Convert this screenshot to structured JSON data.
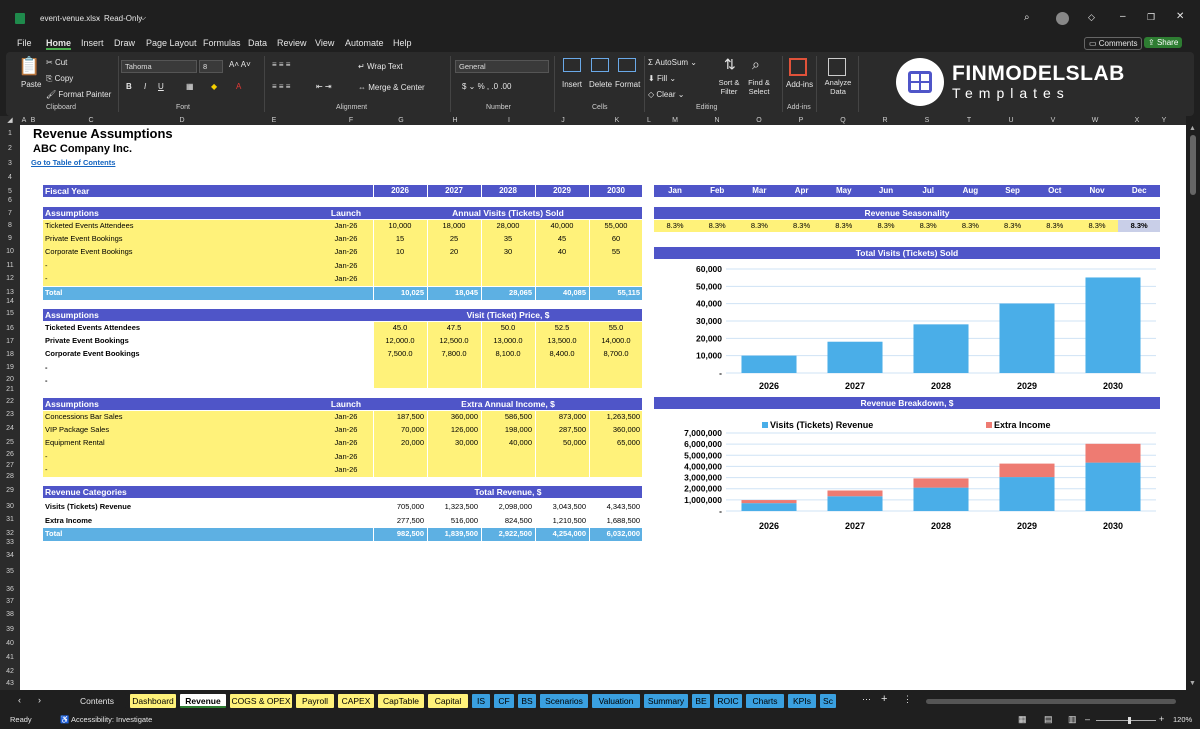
{
  "window": {
    "filename": "event-venue.xlsx",
    "mode": "Read-Only"
  },
  "menu": [
    "File",
    "Home",
    "Insert",
    "Draw",
    "Page Layout",
    "Formulas",
    "Data",
    "Review",
    "View",
    "Automate",
    "Help"
  ],
  "menu_right": {
    "comments": "Comments",
    "share": "Share"
  },
  "ribbon": {
    "paste": "Paste",
    "cut": "Cut",
    "copy": "Copy",
    "format_painter": "Format Painter",
    "clipboard": "Clipboard",
    "font_name": "Tahoma",
    "font_size": "8",
    "font": "Font",
    "wrap_text": "Wrap Text",
    "merge_center": "Merge & Center",
    "alignment": "Alignment",
    "number_format": "General",
    "number": "Number",
    "insert": "Insert",
    "delete": "Delete",
    "format": "Format",
    "cells": "Cells",
    "autosum": "AutoSum",
    "fill": "Fill",
    "clear": "Clear",
    "sort_filter": "Sort & Filter",
    "find_select": "Find & Select",
    "editing": "Editing",
    "addins": "Add-ins",
    "addins_group": "Add-ins",
    "analyze": "Analyze Data",
    "brand": "FINMODELSLAB",
    "brand_sub": "Templates"
  },
  "columns": [
    "A",
    "B",
    "C",
    "D",
    "E",
    "F",
    "G",
    "H",
    "I",
    "J",
    "K",
    "L",
    "M",
    "N",
    "O",
    "P",
    "Q",
    "R",
    "S",
    "T",
    "U",
    "V",
    "W",
    "X",
    "Y"
  ],
  "rows": [
    "1",
    "2",
    "3",
    "4",
    "5",
    "6",
    "7",
    "8",
    "9",
    "10",
    "11",
    "12",
    "13",
    "14",
    "15",
    "16",
    "17",
    "18",
    "19",
    "20",
    "21",
    "22",
    "23",
    "24",
    "25",
    "26",
    "27",
    "28",
    "29",
    "30",
    "31",
    "32",
    "33",
    "34",
    "35",
    "36",
    "37",
    "38",
    "39",
    "40",
    "41",
    "42",
    "43"
  ],
  "sheet": {
    "title": "Revenue Assumptions",
    "company": "ABC Company Inc.",
    "toc_link": "Go to Table of Contents",
    "fiscal_year": "Fiscal Year",
    "years": [
      "2026",
      "2027",
      "2028",
      "2029",
      "2030"
    ],
    "months": [
      "Jan",
      "Feb",
      "Mar",
      "Apr",
      "May",
      "Jun",
      "Jul",
      "Aug",
      "Sep",
      "Oct",
      "Nov",
      "Dec"
    ],
    "assumptions": "Assumptions",
    "launch": "Launch",
    "visits_header": "Annual Visits (Tickets) Sold",
    "visits_rows": [
      {
        "name": "Ticketed Events Attendees",
        "launch": "Jan-26",
        "vals": [
          "10,000",
          "18,000",
          "28,000",
          "40,000",
          "55,000"
        ]
      },
      {
        "name": "Private Event Bookings",
        "launch": "Jan-26",
        "vals": [
          "15",
          "25",
          "35",
          "45",
          "60"
        ]
      },
      {
        "name": "Corporate Event Bookings",
        "launch": "Jan-26",
        "vals": [
          "10",
          "20",
          "30",
          "40",
          "55"
        ]
      },
      {
        "name": "-",
        "launch": "Jan-26",
        "vals": [
          "",
          "",
          "",
          "",
          ""
        ]
      },
      {
        "name": "-",
        "launch": "Jan-26",
        "vals": [
          "",
          "",
          "",
          "",
          ""
        ]
      }
    ],
    "total": "Total",
    "visits_total": [
      "10,025",
      "18,045",
      "28,065",
      "40,085",
      "55,115"
    ],
    "price_header": "Visit (Ticket) Price, $",
    "price_rows": [
      {
        "name": "Ticketed Events Attendees",
        "vals": [
          "45.0",
          "47.5",
          "50.0",
          "52.5",
          "55.0"
        ]
      },
      {
        "name": "Private Event Bookings",
        "vals": [
          "12,000.0",
          "12,500.0",
          "13,000.0",
          "13,500.0",
          "14,000.0"
        ]
      },
      {
        "name": "Corporate Event Bookings",
        "vals": [
          "7,500.0",
          "7,800.0",
          "8,100.0",
          "8,400.0",
          "8,700.0"
        ]
      },
      {
        "name": "-",
        "vals": [
          "",
          "",
          "",
          "",
          ""
        ]
      },
      {
        "name": "-",
        "vals": [
          "",
          "",
          "",
          "",
          ""
        ]
      }
    ],
    "extra_header": "Extra Annual Income, $",
    "extra_rows": [
      {
        "name": "Concessions Bar Sales",
        "launch": "Jan-26",
        "vals": [
          "187,500",
          "360,000",
          "586,500",
          "873,000",
          "1,263,500"
        ]
      },
      {
        "name": "VIP Package Sales",
        "launch": "Jan-26",
        "vals": [
          "70,000",
          "126,000",
          "198,000",
          "287,500",
          "360,000"
        ]
      },
      {
        "name": "Equipment Rental",
        "launch": "Jan-26",
        "vals": [
          "20,000",
          "30,000",
          "40,000",
          "50,000",
          "65,000"
        ]
      },
      {
        "name": "-",
        "launch": "Jan-26",
        "vals": [
          "",
          "",
          "",
          "",
          ""
        ]
      },
      {
        "name": "-",
        "launch": "Jan-26",
        "vals": [
          "",
          "",
          "",
          "",
          ""
        ]
      }
    ],
    "rev_categories": "Revenue Categories",
    "total_revenue": "Total Revenue, $",
    "rev_rows": [
      {
        "name": "Visits (Tickets) Revenue",
        "vals": [
          "705,000",
          "1,323,500",
          "2,098,000",
          "3,043,500",
          "4,343,500"
        ]
      },
      {
        "name": "Extra Income",
        "vals": [
          "277,500",
          "516,000",
          "824,500",
          "1,210,500",
          "1,688,500"
        ]
      }
    ],
    "rev_total": [
      "982,500",
      "1,839,500",
      "2,922,500",
      "4,254,000",
      "6,032,000"
    ],
    "seasonality_header": "Revenue Seasonality",
    "seasonality": [
      "8.3%",
      "8.3%",
      "8.3%",
      "8.3%",
      "8.3%",
      "8.3%",
      "8.3%",
      "8.3%",
      "8.3%",
      "8.3%",
      "8.3%",
      "8.3%"
    ]
  },
  "chart_data": [
    {
      "type": "bar",
      "title": "Total Visits (Tickets) Sold",
      "categories": [
        "2026",
        "2027",
        "2028",
        "2029",
        "2030"
      ],
      "values": [
        10025,
        18045,
        28065,
        40085,
        55115
      ],
      "ylim": [
        0,
        60000
      ],
      "yticks": [
        "60,000",
        "50,000",
        "40,000",
        "30,000",
        "20,000",
        "10,000",
        "-"
      ],
      "color": "#4aaee8"
    },
    {
      "type": "bar",
      "title": "Revenue Breakdown, $",
      "categories": [
        "2026",
        "2027",
        "2028",
        "2029",
        "2030"
      ],
      "stacked": true,
      "series": [
        {
          "name": "Visits (Tickets) Revenue",
          "values": [
            705000,
            1323500,
            2098000,
            3043500,
            4343500
          ],
          "color": "#4aaee8"
        },
        {
          "name": "Extra Income",
          "values": [
            277500,
            516000,
            824500,
            1210500,
            1688500
          ],
          "color": "#ee7b72"
        }
      ],
      "ylim": [
        0,
        7000000
      ],
      "yticks": [
        "7,000,000",
        "6,000,000",
        "5,000,000",
        "4,000,000",
        "3,000,000",
        "2,000,000",
        "1,000,000",
        "-"
      ],
      "legend": "top"
    }
  ],
  "tabs": [
    {
      "label": "Contents",
      "bg": "#1f1f1f",
      "fg": "#e6e6e6"
    },
    {
      "label": "Dashboard",
      "bg": "#fff27a",
      "fg": "#000"
    },
    {
      "label": "Revenue",
      "bg": "#ffffff",
      "fg": "#000",
      "active": true
    },
    {
      "label": "COGS & OPEX",
      "bg": "#fff27a",
      "fg": "#000"
    },
    {
      "label": "Payroll",
      "bg": "#fff27a",
      "fg": "#000"
    },
    {
      "label": "CAPEX",
      "bg": "#fff27a",
      "fg": "#000"
    },
    {
      "label": "CapTable",
      "bg": "#fff27a",
      "fg": "#000"
    },
    {
      "label": "Capital",
      "bg": "#fff27a",
      "fg": "#000"
    },
    {
      "label": "IS",
      "bg": "#3aa0e0",
      "fg": "#000"
    },
    {
      "label": "CF",
      "bg": "#3aa0e0",
      "fg": "#000"
    },
    {
      "label": "BS",
      "bg": "#3aa0e0",
      "fg": "#000"
    },
    {
      "label": "Scenarios",
      "bg": "#3aa0e0",
      "fg": "#000"
    },
    {
      "label": "Valuation",
      "bg": "#3aa0e0",
      "fg": "#000"
    },
    {
      "label": "Summary",
      "bg": "#3aa0e0",
      "fg": "#000"
    },
    {
      "label": "BE",
      "bg": "#3aa0e0",
      "fg": "#000"
    },
    {
      "label": "ROIC",
      "bg": "#3aa0e0",
      "fg": "#000"
    },
    {
      "label": "Charts",
      "bg": "#3aa0e0",
      "fg": "#000"
    },
    {
      "label": "KPIs",
      "bg": "#3aa0e0",
      "fg": "#000"
    },
    {
      "label": "Sc",
      "bg": "#3aa0e0",
      "fg": "#000"
    }
  ],
  "status": {
    "ready": "Ready",
    "accessibility": "Accessibility: Investigate",
    "zoom": "120%"
  }
}
